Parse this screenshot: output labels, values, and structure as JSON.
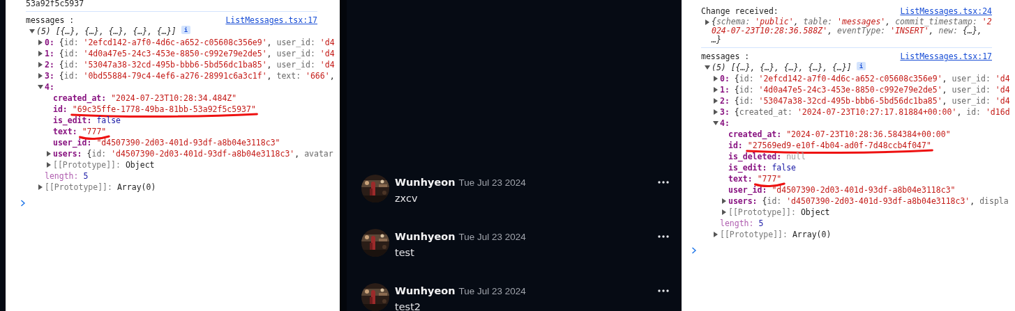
{
  "left_console": {
    "cut_line": "53a92f5c5937",
    "logs": [
      {
        "label": "messages :",
        "source": "ListMessages.tsx:17",
        "tree": {
          "segments": [
            {
              "kind": "summary",
              "text": "(5) [{…}, {…}, {…}, {…}, {…}]"
            }
          ],
          "badge": "i",
          "expanded": true,
          "children": [
            {
              "key": "0:",
              "kind": "own",
              "expanded": false,
              "segments": [
                {
                  "kind": "punct",
                  "text": "{"
                },
                {
                  "kind": "key",
                  "text": "id: "
                },
                {
                  "kind": "string",
                  "text": "'2efcd142-a7f0-4d6c-a652-c05608c356e9'"
                },
                {
                  "kind": "punct",
                  "text": ", "
                },
                {
                  "kind": "key",
                  "text": "user_id: "
                },
                {
                  "kind": "string",
                  "text": "'d4"
                }
              ]
            },
            {
              "key": "1:",
              "kind": "own",
              "expanded": false,
              "segments": [
                {
                  "kind": "punct",
                  "text": "{"
                },
                {
                  "kind": "key",
                  "text": "id: "
                },
                {
                  "kind": "string",
                  "text": "'4d0a47e5-24c3-453e-8850-c992e79e2de5'"
                },
                {
                  "kind": "punct",
                  "text": ", "
                },
                {
                  "kind": "key",
                  "text": "user_id: "
                },
                {
                  "kind": "string",
                  "text": "'d4"
                }
              ]
            },
            {
              "key": "2:",
              "kind": "own",
              "expanded": false,
              "segments": [
                {
                  "kind": "punct",
                  "text": "{"
                },
                {
                  "kind": "key",
                  "text": "id: "
                },
                {
                  "kind": "string",
                  "text": "'53047a38-32cd-495b-bbb6-5bd56dc1ba85'"
                },
                {
                  "kind": "punct",
                  "text": ", "
                },
                {
                  "kind": "key",
                  "text": "user_id: "
                },
                {
                  "kind": "string",
                  "text": "'d4"
                }
              ]
            },
            {
              "key": "3:",
              "kind": "own",
              "expanded": false,
              "segments": [
                {
                  "kind": "punct",
                  "text": "{"
                },
                {
                  "kind": "key",
                  "text": "id: "
                },
                {
                  "kind": "string",
                  "text": "'0bd55884-79c4-4ef6-a276-28991c6a3c1f'"
                },
                {
                  "kind": "punct",
                  "text": ", "
                },
                {
                  "kind": "key",
                  "text": "text: "
                },
                {
                  "kind": "string",
                  "text": "'666'"
                },
                {
                  "kind": "punct",
                  "text": ","
                }
              ]
            },
            {
              "key": "4:",
              "kind": "own",
              "expanded": true,
              "children": [
                {
                  "key": "created_at:",
                  "kind": "own",
                  "underlined": false,
                  "segments": [
                    {
                      "kind": "string",
                      "text": "\"2024-07-23T10:28:34.484Z\""
                    }
                  ]
                },
                {
                  "key": "id:",
                  "kind": "own",
                  "underlined": true,
                  "segments": [
                    {
                      "kind": "string",
                      "text": "\"69c35ffe-1778-49ba-81bb-53a92f5c5937\""
                    }
                  ]
                },
                {
                  "key": "is_edit:",
                  "kind": "own",
                  "underlined": false,
                  "segments": [
                    {
                      "kind": "bool",
                      "text": "false"
                    }
                  ]
                },
                {
                  "key": "text:",
                  "kind": "own",
                  "underlined": true,
                  "segments": [
                    {
                      "kind": "string",
                      "text": "\"777\""
                    }
                  ]
                },
                {
                  "key": "user_id:",
                  "kind": "own",
                  "underlined": false,
                  "segments": [
                    {
                      "kind": "string",
                      "text": "\"d4507390-2d03-401d-93df-a8b04e3118c3\""
                    }
                  ]
                },
                {
                  "key": "users:",
                  "kind": "own",
                  "underlined": false,
                  "expanded": false,
                  "segments": [
                    {
                      "kind": "punct",
                      "text": "{"
                    },
                    {
                      "kind": "key",
                      "text": "id: "
                    },
                    {
                      "kind": "string",
                      "text": "'d4507390-2d03-401d-93df-a8b04e3118c3'"
                    },
                    {
                      "kind": "punct",
                      "text": ", "
                    },
                    {
                      "kind": "key",
                      "text": "avatar"
                    }
                  ]
                },
                {
                  "key": "[[Prototype]]:",
                  "kind": "internal",
                  "underlined": false,
                  "expanded": false,
                  "segments": [
                    {
                      "kind": "plain",
                      "text": "Object"
                    }
                  ]
                }
              ]
            },
            {
              "key": "length:",
              "kind": "length",
              "segments": [
                {
                  "kind": "number",
                  "text": "5"
                }
              ]
            },
            {
              "key": "[[Prototype]]:",
              "kind": "internal",
              "expanded": false,
              "segments": [
                {
                  "kind": "plain",
                  "text": "Array(0)"
                }
              ]
            }
          ]
        }
      }
    ]
  },
  "chat": {
    "messages": [
      {
        "author": "Wunhyeon",
        "date": "Tue Jul 23 2024",
        "text": "zxcv"
      },
      {
        "author": "Wunhyeon",
        "date": "Tue Jul 23 2024",
        "text": "test"
      },
      {
        "author": "Wunhyeon",
        "date": "Tue Jul 23 2024",
        "text": "test2"
      }
    ]
  },
  "right_console": {
    "logs": [
      {
        "label": "Change received:",
        "source": "ListMessages.tsx:24",
        "tree": {
          "expanded": false,
          "segments": [
            {
              "kind": "punct",
              "text": "{"
            },
            {
              "kind": "key",
              "text": "schema: "
            },
            {
              "kind": "string",
              "text": "'public'"
            },
            {
              "kind": "punct",
              "text": ", "
            },
            {
              "kind": "key",
              "text": "table: "
            },
            {
              "kind": "string",
              "text": "'messages'"
            },
            {
              "kind": "punct",
              "text": ", "
            },
            {
              "kind": "key",
              "text": "commit_timestamp: "
            },
            {
              "kind": "string",
              "text": "'2024-07-23T10:28:36.588Z'"
            },
            {
              "kind": "punct",
              "text": ", "
            },
            {
              "kind": "key",
              "text": "eventType: "
            },
            {
              "kind": "string",
              "text": "'INSERT'"
            },
            {
              "kind": "punct",
              "text": ", "
            },
            {
              "kind": "key",
              "text": "new: "
            },
            {
              "kind": "punct",
              "text": "{…}, …}"
            }
          ]
        }
      },
      {
        "label": "messages :",
        "source": "ListMessages.tsx:17",
        "tree": {
          "segments": [
            {
              "kind": "summary",
              "text": "(5) [{…}, {…}, {…}, {…}, {…}]"
            }
          ],
          "badge": "i",
          "expanded": true,
          "children": [
            {
              "key": "0:",
              "kind": "own",
              "expanded": false,
              "segments": [
                {
                  "kind": "punct",
                  "text": "{"
                },
                {
                  "kind": "key",
                  "text": "id: "
                },
                {
                  "kind": "string",
                  "text": "'2efcd142-a7f0-4d6c-a652-c05608c356e9'"
                },
                {
                  "kind": "punct",
                  "text": ", "
                },
                {
                  "kind": "key",
                  "text": "user_id: "
                },
                {
                  "kind": "string",
                  "text": "'d4"
                }
              ]
            },
            {
              "key": "1:",
              "kind": "own",
              "expanded": false,
              "segments": [
                {
                  "kind": "punct",
                  "text": "{"
                },
                {
                  "kind": "key",
                  "text": "id: "
                },
                {
                  "kind": "string",
                  "text": "'4d0a47e5-24c3-453e-8850-c992e79e2de5'"
                },
                {
                  "kind": "punct",
                  "text": ", "
                },
                {
                  "kind": "key",
                  "text": "user_id: "
                },
                {
                  "kind": "string",
                  "text": "'d4"
                }
              ]
            },
            {
              "key": "2:",
              "kind": "own",
              "expanded": false,
              "segments": [
                {
                  "kind": "punct",
                  "text": "{"
                },
                {
                  "kind": "key",
                  "text": "id: "
                },
                {
                  "kind": "string",
                  "text": "'53047a38-32cd-495b-bbb6-5bd56dc1ba85'"
                },
                {
                  "kind": "punct",
                  "text": ", "
                },
                {
                  "kind": "key",
                  "text": "user_id: "
                },
                {
                  "kind": "string",
                  "text": "'d4"
                }
              ]
            },
            {
              "key": "3:",
              "kind": "own",
              "expanded": false,
              "segments": [
                {
                  "kind": "punct",
                  "text": "{"
                },
                {
                  "kind": "key",
                  "text": "created_at: "
                },
                {
                  "kind": "string",
                  "text": "'2024-07-23T10:27:17.81884+00:00'"
                },
                {
                  "kind": "punct",
                  "text": ", "
                },
                {
                  "kind": "key",
                  "text": "id: "
                },
                {
                  "kind": "string",
                  "text": "'d16d"
                }
              ]
            },
            {
              "key": "4:",
              "kind": "own",
              "expanded": true,
              "children": [
                {
                  "key": "created_at:",
                  "kind": "own",
                  "underlined": false,
                  "segments": [
                    {
                      "kind": "string",
                      "text": "\"2024-07-23T10:28:36.584384+00:00\""
                    }
                  ]
                },
                {
                  "key": "id:",
                  "kind": "own",
                  "underlined": true,
                  "segments": [
                    {
                      "kind": "string",
                      "text": "\"27569ed9-e10f-4b04-ad0f-7d48ccb4f047\""
                    }
                  ]
                },
                {
                  "key": "is_deleted:",
                  "kind": "own",
                  "underlined": false,
                  "segments": [
                    {
                      "kind": "null",
                      "text": "null"
                    }
                  ]
                },
                {
                  "key": "is_edit:",
                  "kind": "own",
                  "underlined": false,
                  "segments": [
                    {
                      "kind": "bool",
                      "text": "false"
                    }
                  ]
                },
                {
                  "key": "text:",
                  "kind": "own",
                  "underlined": true,
                  "segments": [
                    {
                      "kind": "string",
                      "text": "\"777\""
                    }
                  ]
                },
                {
                  "key": "user_id:",
                  "kind": "own",
                  "underlined": false,
                  "segments": [
                    {
                      "kind": "string",
                      "text": "\"d4507390-2d03-401d-93df-a8b04e3118c3\""
                    }
                  ]
                },
                {
                  "key": "users:",
                  "kind": "own",
                  "underlined": false,
                  "expanded": false,
                  "segments": [
                    {
                      "kind": "punct",
                      "text": "{"
                    },
                    {
                      "kind": "key",
                      "text": "id: "
                    },
                    {
                      "kind": "string",
                      "text": "'d4507390-2d03-401d-93df-a8b04e3118c3'"
                    },
                    {
                      "kind": "punct",
                      "text": ", "
                    },
                    {
                      "kind": "key",
                      "text": "displa"
                    }
                  ]
                },
                {
                  "key": "[[Prototype]]:",
                  "kind": "internal",
                  "underlined": false,
                  "expanded": false,
                  "segments": [
                    {
                      "kind": "plain",
                      "text": "Object"
                    }
                  ]
                }
              ]
            },
            {
              "key": "length:",
              "kind": "length",
              "segments": [
                {
                  "kind": "number",
                  "text": "5"
                }
              ]
            },
            {
              "key": "[[Prototype]]:",
              "kind": "internal",
              "expanded": false,
              "segments": [
                {
                  "kind": "plain",
                  "text": "Array(0)"
                }
              ]
            }
          ]
        }
      }
    ]
  }
}
